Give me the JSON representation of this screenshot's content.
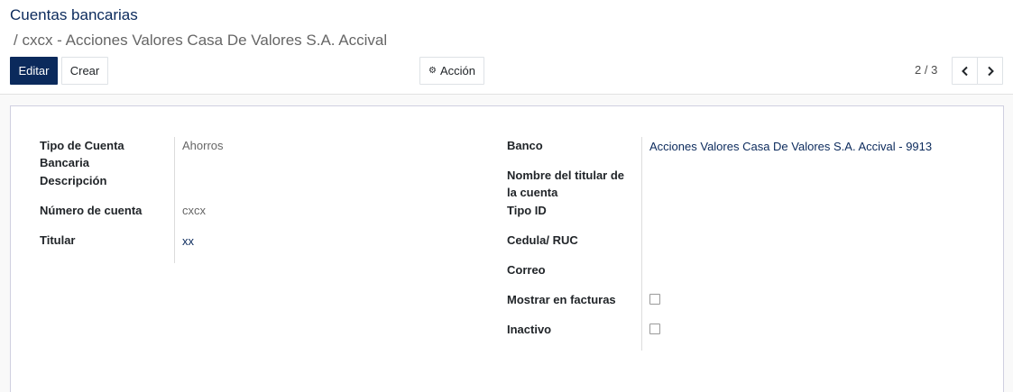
{
  "breadcrumb": {
    "root": "Cuentas bancarias",
    "current": "/ cxcx - Acciones Valores Casa De Valores S.A. Accival"
  },
  "toolbar": {
    "edit_label": "Editar",
    "create_label": "Crear",
    "action_label": "Acción"
  },
  "pager": {
    "value": "2 / 3"
  },
  "form": {
    "left": {
      "tipo_cuenta_label_1": "Tipo de Cuenta",
      "tipo_cuenta_label_2": "Bancaria",
      "tipo_cuenta_value": "Ahorros",
      "descripcion_label": "Descripción",
      "numero_cuenta_label": "Número de cuenta",
      "numero_cuenta_value": "cxcx",
      "titular_label": "Titular",
      "titular_value": "xx"
    },
    "right": {
      "banco_label": "Banco",
      "banco_value": "Acciones Valores Casa De Valores S.A. Accival - 9913",
      "nombre_titular_label_1": "Nombre del titular de",
      "nombre_titular_label_2": "la cuenta",
      "tipo_id_label": "Tipo ID",
      "cedula_label": "Cedula/ RUC",
      "correo_label": "Correo",
      "mostrar_facturas_label": "Mostrar en facturas",
      "mostrar_facturas_checked": false,
      "inactivo_label": "Inactivo",
      "inactivo_checked": false
    }
  }
}
